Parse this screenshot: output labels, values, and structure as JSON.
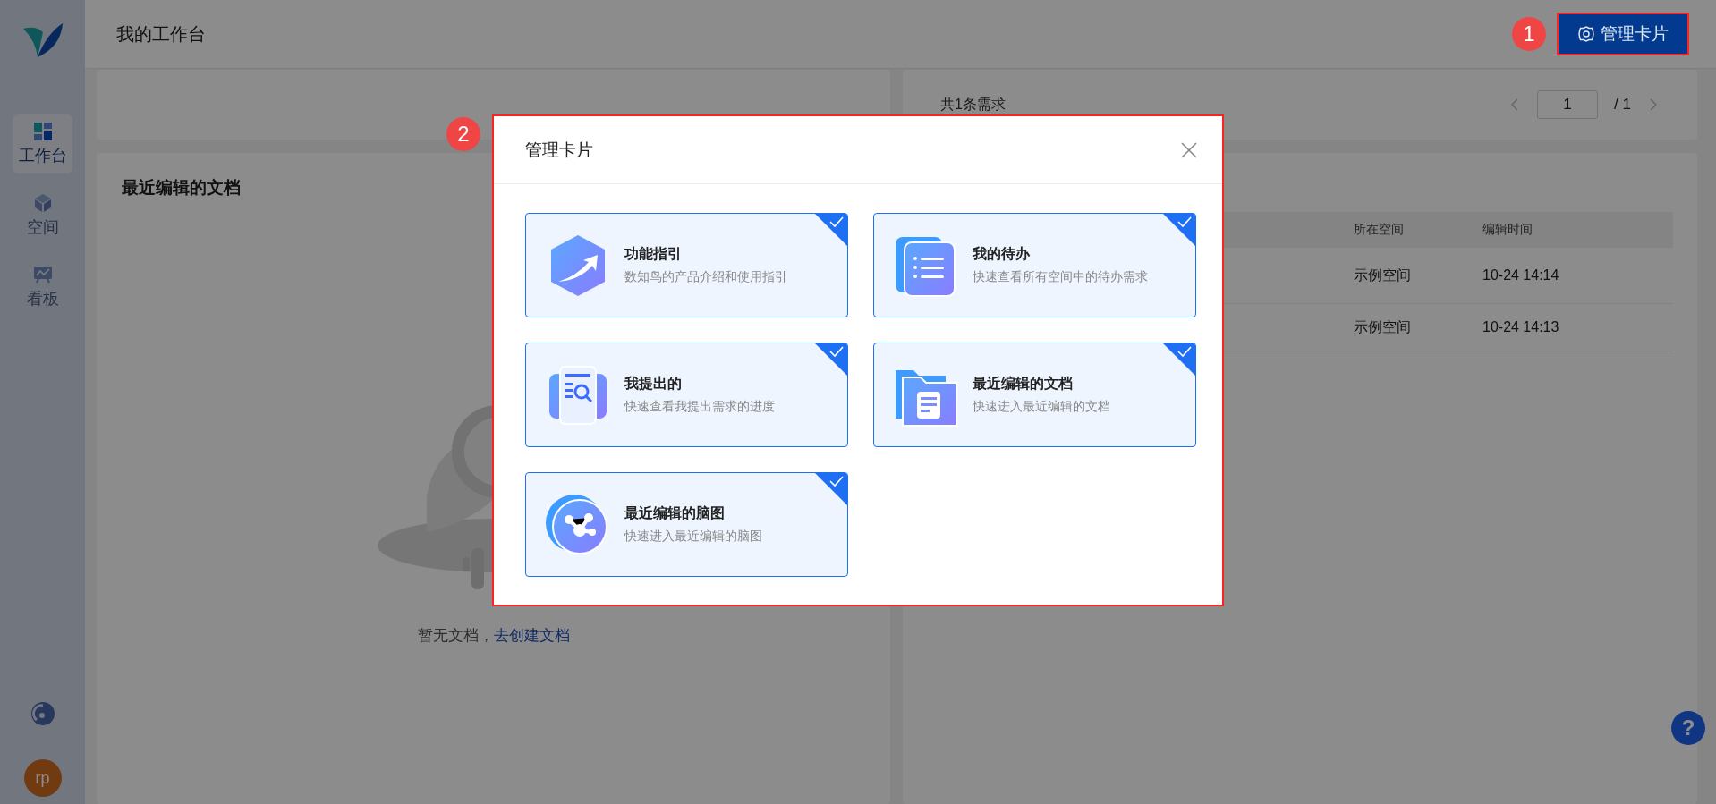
{
  "sidebar": {
    "items": [
      {
        "kind": "workbench",
        "label": "工作台",
        "selected": true
      },
      {
        "kind": "space",
        "label": "空间",
        "selected": false
      },
      {
        "kind": "board",
        "label": "看板",
        "selected": false
      }
    ],
    "avatar": "rp"
  },
  "header": {
    "title": "我的工作台",
    "button": "管理卡片"
  },
  "requests_card": {
    "total": "共1条需求",
    "page": "1",
    "pages": "/ 1"
  },
  "docs_card": {
    "title": "最近编辑的文档",
    "empty_text": "暂无文档，",
    "link": "去创建文档"
  },
  "recent_table": {
    "columns": [
      "所在空间",
      "编辑时间"
    ],
    "rows": [
      [
        "示例空间",
        "10-24 14:14"
      ],
      [
        "示例空间",
        "10-24 14:13"
      ]
    ]
  },
  "help": "?",
  "modal": {
    "title": "管理卡片",
    "cards": [
      {
        "kind": "guide",
        "title": "功能指引",
        "desc": "数知鸟的产品介绍和使用指引",
        "selected": true
      },
      {
        "kind": "todo",
        "title": "我的待办",
        "desc": "快速查看所有空间中的待办需求",
        "selected": true
      },
      {
        "kind": "submitted",
        "title": "我提出的",
        "desc": "快速查看我提出需求的进度",
        "selected": true
      },
      {
        "kind": "docs",
        "title": "最近编辑的文档",
        "desc": "快速进入最近编辑的文档",
        "selected": true
      },
      {
        "kind": "mindmap",
        "title": "最近编辑的脑图",
        "desc": "快速进入最近编辑的脑图",
        "selected": true
      }
    ]
  },
  "callouts": [
    "1",
    "2"
  ]
}
